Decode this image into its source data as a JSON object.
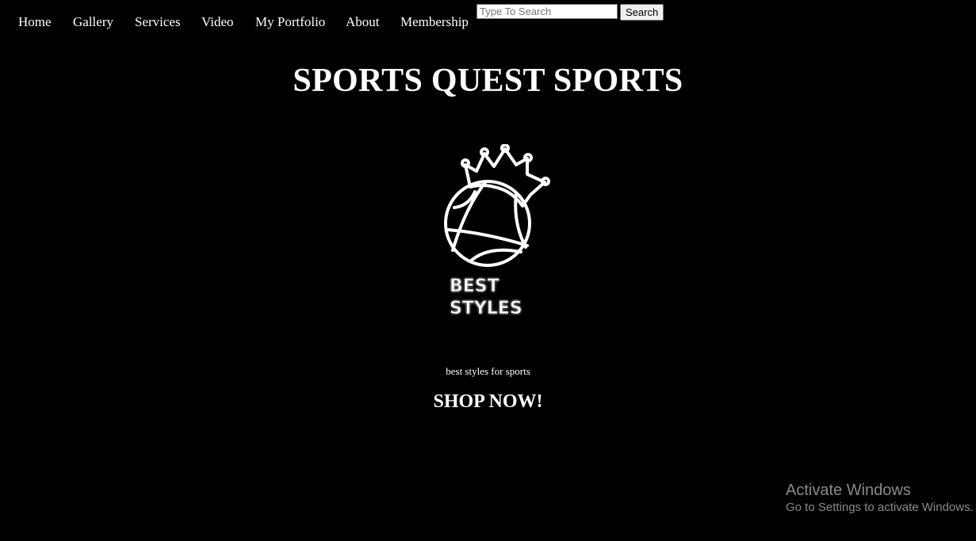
{
  "nav": {
    "items": [
      {
        "label": "Home"
      },
      {
        "label": "Gallery"
      },
      {
        "label": "Services"
      },
      {
        "label": "Video"
      },
      {
        "label": "My Portfolio"
      },
      {
        "label": "About"
      },
      {
        "label": "Membership"
      }
    ]
  },
  "search": {
    "placeholder": "Type To Search",
    "value": "",
    "button_label": "Search"
  },
  "hero": {
    "title": "SPORTS QUEST SPORTS",
    "logo_text_line1": "BEST",
    "logo_text_line2": "STYLES",
    "tagline": "best styles for sports",
    "cta": "SHOP NOW!"
  },
  "watermark": {
    "title": "Activate Windows",
    "subtitle": "Go to Settings to activate Windows."
  },
  "colors": {
    "background": "#000000",
    "text": "#ffffff",
    "watermark": "#8a8a8a"
  }
}
